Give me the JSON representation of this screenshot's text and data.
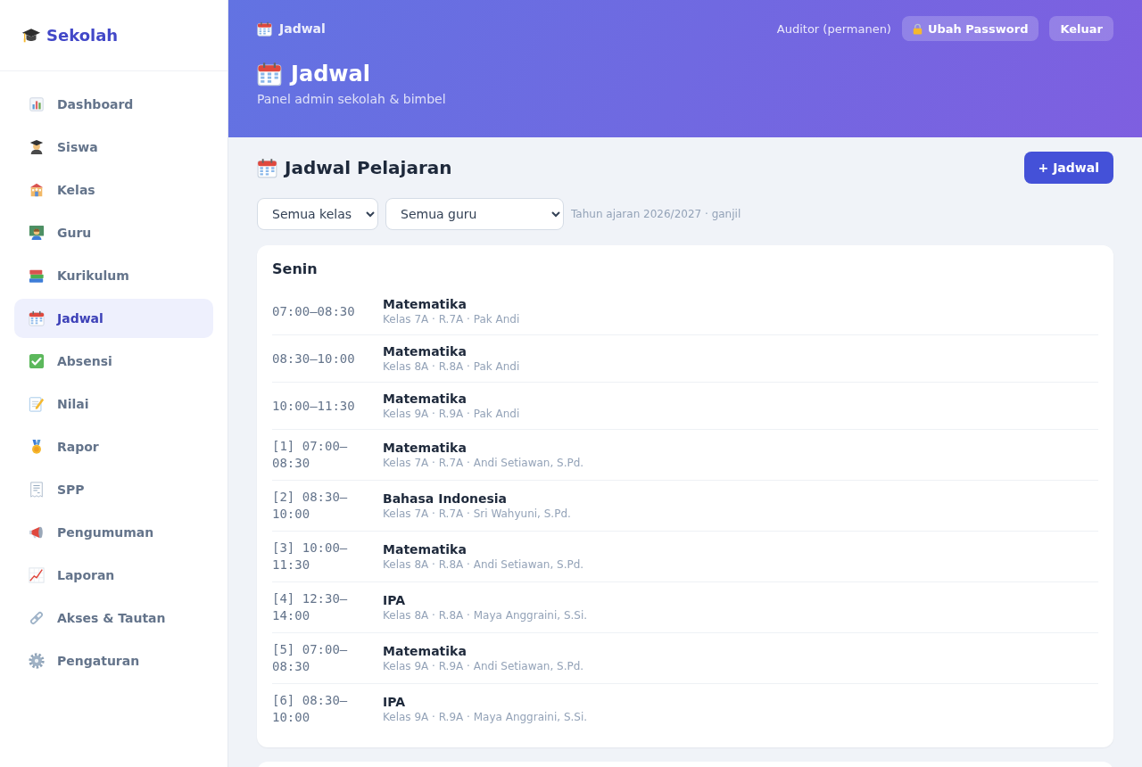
{
  "sidebar": {
    "logo": "Sekolah",
    "items": [
      {
        "label": "Dashboard",
        "selected": false
      },
      {
        "label": "Siswa",
        "selected": false
      },
      {
        "label": "Kelas",
        "selected": false
      },
      {
        "label": "Guru",
        "selected": false
      },
      {
        "label": "Kurikulum",
        "selected": false
      },
      {
        "label": "Jadwal",
        "selected": true
      },
      {
        "label": "Absensi",
        "selected": false
      },
      {
        "label": "Nilai",
        "selected": false
      },
      {
        "label": "Rapor",
        "selected": false
      },
      {
        "label": "SPP",
        "selected": false
      },
      {
        "label": "Pengumuman",
        "selected": false
      },
      {
        "label": "Laporan",
        "selected": false
      },
      {
        "label": "Akses & Tautan",
        "selected": false
      },
      {
        "label": "Pengaturan",
        "selected": false
      }
    ]
  },
  "header": {
    "breadcrumb": "Jadwal",
    "user_role": "Auditor (permanen)",
    "change_password_button": "Ubah Password",
    "logout_button": "Keluar",
    "title": "Jadwal",
    "subtitle": "Panel admin sekolah & bimbel"
  },
  "section": {
    "title": "Jadwal Pelajaran",
    "add_button": "+ Jadwal",
    "filters": [
      {
        "value": "Semua kelas"
      },
      {
        "value": "Semua guru"
      }
    ],
    "term_note": "Tahun ajaran 2026/2027 · ganjil"
  },
  "schedule": [
    {
      "day": "Senin",
      "entries": [
        {
          "time": "07:00–08:30",
          "subject": "Matematika",
          "details": "Kelas 7A · R.7A · Pak Andi"
        },
        {
          "time": "08:30–10:00",
          "subject": "Matematika",
          "details": "Kelas 8A · R.8A · Pak Andi"
        },
        {
          "time": "10:00–11:30",
          "subject": "Matematika",
          "details": "Kelas 9A · R.9A · Pak Andi"
        },
        {
          "time": "[1] 07:00–08:30",
          "subject": "Matematika",
          "details": "Kelas 7A · R.7A · Andi Setiawan, S.Pd."
        },
        {
          "time": "[2] 08:30–10:00",
          "subject": "Bahasa Indonesia",
          "details": "Kelas 7A · R.7A · Sri Wahyuni, S.Pd."
        },
        {
          "time": "[3] 10:00–11:30",
          "subject": "Matematika",
          "details": "Kelas 8A · R.8A · Andi Setiawan, S.Pd."
        },
        {
          "time": "[4] 12:30–14:00",
          "subject": "IPA",
          "details": "Kelas 8A · R.8A · Maya Anggraini, S.Si."
        },
        {
          "time": "[5] 07:00–08:30",
          "subject": "Matematika",
          "details": "Kelas 9A · R.9A · Andi Setiawan, S.Pd."
        },
        {
          "time": "[6] 08:30–10:00",
          "subject": "IPA",
          "details": "Kelas 9A · R.9A · Maya Anggraini, S.Si."
        }
      ]
    }
  ]
}
